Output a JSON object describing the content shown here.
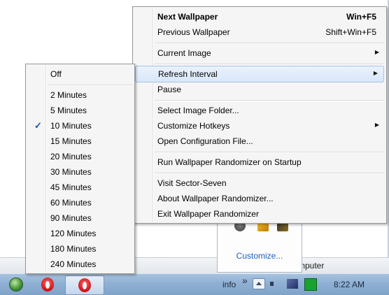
{
  "background": {
    "status_text": "mputer"
  },
  "main_menu": {
    "items": [
      {
        "label": "Next Wallpaper",
        "shortcut": "Win+F5"
      },
      {
        "label": "Previous Wallpaper",
        "shortcut": "Shift+Win+F5"
      },
      {
        "label": "Current Image"
      },
      {
        "label": "Refresh Interval"
      },
      {
        "label": "Pause"
      },
      {
        "label": "Select Image Folder..."
      },
      {
        "label": "Customize Hotkeys"
      },
      {
        "label": "Open Configuration File..."
      },
      {
        "label": "Run Wallpaper Randomizer on Startup"
      },
      {
        "label": "Visit Sector-Seven"
      },
      {
        "label": "About Wallpaper Randomizer..."
      },
      {
        "label": "Exit Wallpaper Randomizer"
      }
    ]
  },
  "interval_menu": {
    "selected": "10 Minutes",
    "items": [
      {
        "label": "Off"
      },
      {
        "label": "2 Minutes"
      },
      {
        "label": "5 Minutes"
      },
      {
        "label": "10 Minutes",
        "checked": true
      },
      {
        "label": "15 Minutes"
      },
      {
        "label": "20 Minutes"
      },
      {
        "label": "30 Minutes"
      },
      {
        "label": "45 Minutes"
      },
      {
        "label": "60 Minutes"
      },
      {
        "label": "90 Minutes"
      },
      {
        "label": "120 Minutes"
      },
      {
        "label": "180 Minutes"
      },
      {
        "label": "240 Minutes"
      }
    ]
  },
  "flyout": {
    "customize_label": "Customize..."
  },
  "taskbar": {
    "tray_label": "info",
    "overflow_glyph": "»",
    "clock": "8:22 AM"
  }
}
